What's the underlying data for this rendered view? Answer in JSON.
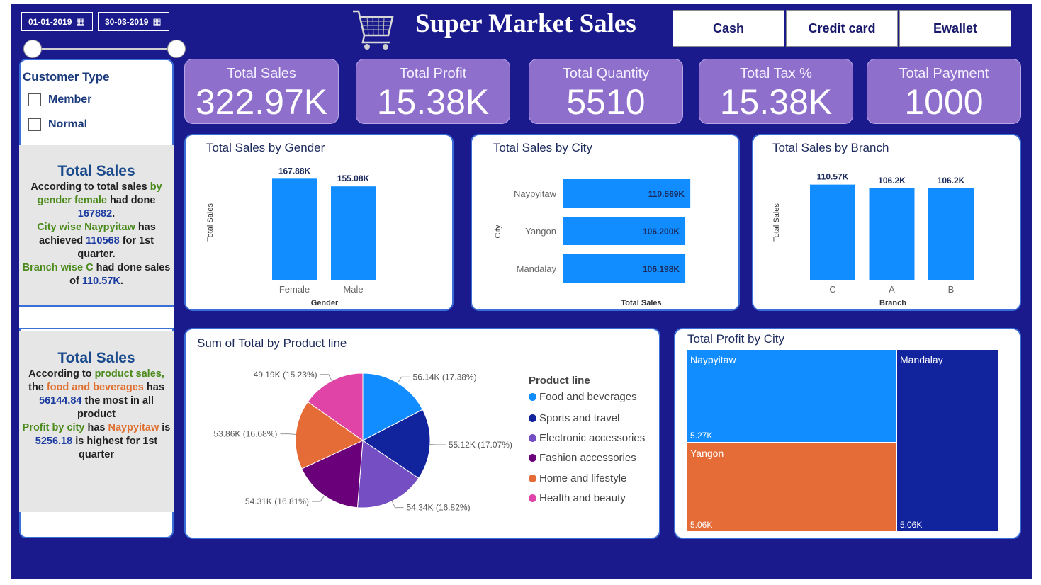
{
  "header": {
    "title": "Super Market Sales",
    "date_start": "01-01-2019",
    "date_end": "30-03-2019",
    "payments": [
      "Cash",
      "Credit card",
      "Ewallet"
    ]
  },
  "kpis": [
    {
      "label": "Total Sales",
      "value": "322.97K"
    },
    {
      "label": "Total Profit",
      "value": "15.38K"
    },
    {
      "label": "Total Quantity",
      "value": "5510"
    },
    {
      "label": "Total Tax %",
      "value": "15.38K"
    },
    {
      "label": "Total Payment",
      "value": "1000"
    }
  ],
  "customer_type": {
    "title": "Customer Type",
    "options": [
      "Member",
      "Normal"
    ]
  },
  "insight1": {
    "heading": "Total Sales",
    "t1": "According to total sales ",
    "t2": "by gender female",
    "t3": " had done ",
    "t4": "167882",
    "t5": ".",
    "t6": "City wise Naypyitaw",
    "t7": " has achieved ",
    "t8": "110568",
    "t9": " for 1st quarter.",
    "t10": "Branch wise C",
    "t11": " had done sales of ",
    "t12": "110.57K",
    "t13": "."
  },
  "insight2": {
    "heading": "Total Sales",
    "t1": "According to ",
    "t2": " product sales,",
    "t3": " the ",
    "t4": "food and beverages",
    "t5": " has ",
    "t6": "56144.84",
    "t7": " the most in all product",
    "t8": "Profit by city",
    "t9": " has ",
    "t10": "Naypyitaw",
    "t11": " is ",
    "t12": "5256.18",
    "t13": " is highest for 1st quarter"
  },
  "colors": {
    "background": "#1a1a8c",
    "bar": "#118dff",
    "kpi": "#8f6fcc"
  },
  "chart_data": [
    {
      "type": "bar",
      "title": "Total Sales by Gender",
      "xlabel": "Gender",
      "ylabel": "Total Sales",
      "categories": [
        "Female",
        "Male"
      ],
      "values": [
        167.88,
        155.08
      ],
      "labels": [
        "167.88K",
        "155.08K"
      ],
      "ylim": [
        0,
        200
      ]
    },
    {
      "type": "bar",
      "orientation": "horizontal",
      "title": "Total Sales by City",
      "xlabel": "Total Sales",
      "ylabel": "City",
      "categories": [
        "Naypyitaw",
        "Yangon",
        "Mandalay"
      ],
      "values": [
        110.569,
        106.2,
        106.198
      ],
      "labels": [
        "110.569K",
        "106.200K",
        "106.198K"
      ],
      "xlim": [
        0,
        150
      ]
    },
    {
      "type": "bar",
      "title": "Total Sales by Branch",
      "xlabel": "Branch",
      "ylabel": "Total Sales",
      "categories": [
        "C",
        "A",
        "B"
      ],
      "values": [
        110.57,
        106.2,
        106.2
      ],
      "labels": [
        "110.57K",
        "106.2K",
        "106.2K"
      ],
      "ylim": [
        0,
        130
      ]
    },
    {
      "type": "pie",
      "title": "Sum of Total by Product line",
      "legend_title": "Product line",
      "categories": [
        "Food and beverages",
        "Sports and travel",
        "Electronic accessories",
        "Fashion accessories",
        "Home and lifestyle",
        "Health and beauty"
      ],
      "values": [
        56.14,
        55.12,
        54.34,
        54.31,
        53.86,
        49.19
      ],
      "labels": [
        "56.14K (17.38%)",
        "55.12K (17.07%)",
        "54.34K (16.82%)",
        "54.31K (16.81%)",
        "53.86K (16.68%)",
        "49.19K (15.23%)"
      ],
      "colors": [
        "#118dff",
        "#12239e",
        "#744ec2",
        "#6b007b",
        "#e66c37",
        "#e044a7"
      ]
    },
    {
      "type": "treemap",
      "title": "Total Profit by City",
      "categories": [
        "Naypyitaw",
        "Yangon",
        "Mandalay"
      ],
      "values": [
        5.27,
        5.06,
        5.06
      ],
      "labels": [
        "5.27K",
        "5.06K",
        "5.06K"
      ],
      "colors": [
        "#118dff",
        "#e66c37",
        "#12239e"
      ]
    }
  ]
}
